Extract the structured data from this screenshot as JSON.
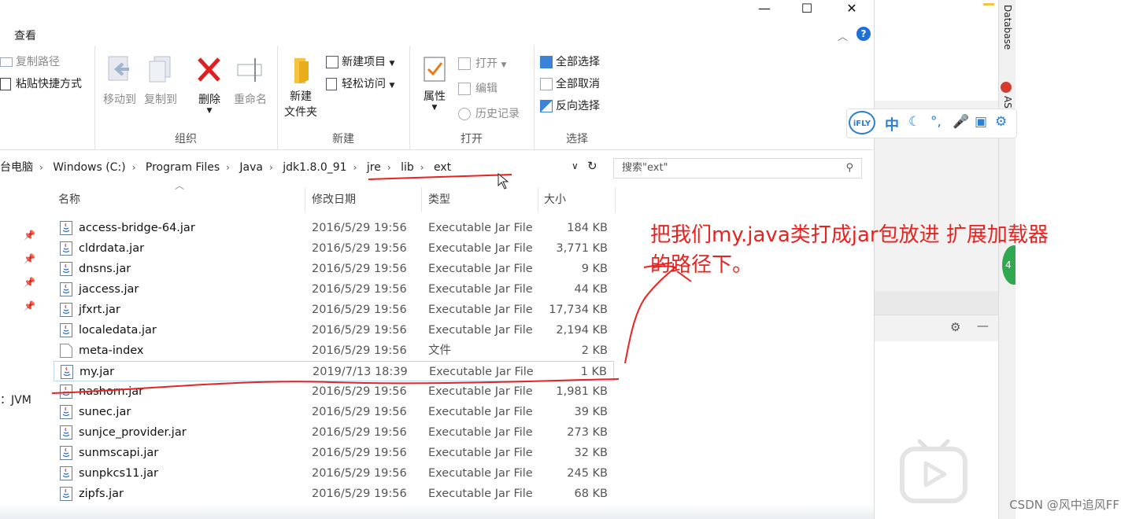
{
  "window": {
    "tabs": {
      "view": "查看"
    },
    "controls": {
      "minimize": "—",
      "maximize": "☐",
      "close": "✕"
    }
  },
  "ribbon": {
    "clipboard": {
      "copy_path": "复制路径",
      "paste_shortcut": "粘贴快捷方式"
    },
    "organize": {
      "label": "组织",
      "move_to": "移动到",
      "copy_to": "复制到",
      "delete": "删除",
      "rename": "重命名"
    },
    "new": {
      "label": "新建",
      "new_item": "新建项目",
      "easy_access": "轻松访问",
      "new_folder_line1": "新建",
      "new_folder_line2": "文件夹"
    },
    "open": {
      "label": "打开",
      "properties": "属性",
      "open": "打开",
      "edit": "编辑",
      "history": "历史记录"
    },
    "select": {
      "label": "选择",
      "select_all": "全部选择",
      "select_none": "全部取消",
      "invert": "反向选择"
    }
  },
  "address": {
    "crumbs": [
      "台电脑",
      "Windows (C:)",
      "Program Files",
      "Java",
      "jdk1.8.0_91",
      "jre",
      "lib",
      "ext"
    ],
    "search_placeholder": "搜索\"ext\""
  },
  "columns": {
    "name": "名称",
    "date": "修改日期",
    "type": "类型",
    "size": "大小"
  },
  "files": [
    {
      "name": "access-bridge-64.jar",
      "date": "2016/5/29 19:56",
      "type": "Executable Jar File",
      "size": "184 KB",
      "icon": "jar-file-icon"
    },
    {
      "name": "cldrdata.jar",
      "date": "2016/5/29 19:56",
      "type": "Executable Jar File",
      "size": "3,771 KB",
      "icon": "jar-file-icon"
    },
    {
      "name": "dnsns.jar",
      "date": "2016/5/29 19:56",
      "type": "Executable Jar File",
      "size": "9 KB",
      "icon": "jar-file-icon"
    },
    {
      "name": "jaccess.jar",
      "date": "2016/5/29 19:56",
      "type": "Executable Jar File",
      "size": "44 KB",
      "icon": "jar-file-icon"
    },
    {
      "name": "jfxrt.jar",
      "date": "2016/5/29 19:56",
      "type": "Executable Jar File",
      "size": "17,734 KB",
      "icon": "jar-file-icon"
    },
    {
      "name": "localedata.jar",
      "date": "2016/5/29 19:56",
      "type": "Executable Jar File",
      "size": "2,194 KB",
      "icon": "jar-file-icon"
    },
    {
      "name": "meta-index",
      "date": "2016/5/29 19:56",
      "type": "文件",
      "size": "2 KB",
      "icon": "blank-file-icon"
    },
    {
      "name": "my.jar",
      "date": "2019/7/13 18:39",
      "type": "Executable Jar File",
      "size": "1 KB",
      "icon": "jar-file-icon"
    },
    {
      "name": "nashorn.jar",
      "date": "2016/5/29 19:56",
      "type": "Executable Jar File",
      "size": "1,981 KB",
      "icon": "jar-file-icon"
    },
    {
      "name": "sunec.jar",
      "date": "2016/5/29 19:56",
      "type": "Executable Jar File",
      "size": "39 KB",
      "icon": "jar-file-icon"
    },
    {
      "name": "sunjce_provider.jar",
      "date": "2016/5/29 19:56",
      "type": "Executable Jar File",
      "size": "273 KB",
      "icon": "jar-file-icon"
    },
    {
      "name": "sunmscapi.jar",
      "date": "2016/5/29 19:56",
      "type": "Executable Jar File",
      "size": "32 KB",
      "icon": "jar-file-icon"
    },
    {
      "name": "sunpkcs11.jar",
      "date": "2016/5/29 19:56",
      "type": "Executable Jar File",
      "size": "245 KB",
      "icon": "jar-file-icon"
    },
    {
      "name": "zipfs.jar",
      "date": "2016/5/29 19:56",
      "type": "Executable Jar File",
      "size": "68 KB",
      "icon": "jar-file-icon"
    }
  ],
  "left_pane": {
    "jvm_label": "：JVM"
  },
  "annotation": {
    "line1": "把我们my.java类打成jar包放进 扩展加载器",
    "line2": "的路径下。",
    "color": "#e8231f"
  },
  "side_app": {
    "database_label": "Database",
    "as_label": "AS",
    "ifly_logo": "iFLY",
    "ifly_lang": "中",
    "green_badge": "4"
  },
  "watermark": "CSDN @风中追风FF",
  "colors": {
    "accent": "#1e6fd6",
    "annotation": "#e8231f",
    "selection_border": "#b9d9f5"
  }
}
